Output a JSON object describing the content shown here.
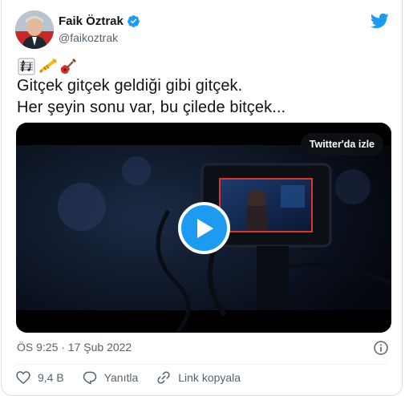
{
  "author": {
    "name": "Faik Öztrak",
    "handle": "@faikoztrak",
    "verified": true
  },
  "tweet": {
    "emojis": [
      "sheet-music-emoji",
      "trumpet-emoji",
      "guitar-emoji"
    ],
    "lines": [
      "Gitçek gitçek geldiği gibi gitçek.",
      "Her şeyin sonu var, bu çilede bitçek..."
    ]
  },
  "media": {
    "watch_label": "Twitter'da izle",
    "play_icon": "play-icon"
  },
  "meta": {
    "timestamp": "ÖS 9:25 · 17 Şub 2022"
  },
  "actions": {
    "like_count": "9,4 B",
    "reply_label": "Yanıtla",
    "copy_link_label": "Link kopyala"
  },
  "colors": {
    "accent": "#1d9bf0",
    "text": "#0f1419",
    "secondary": "#536471",
    "like": "#f91880"
  }
}
